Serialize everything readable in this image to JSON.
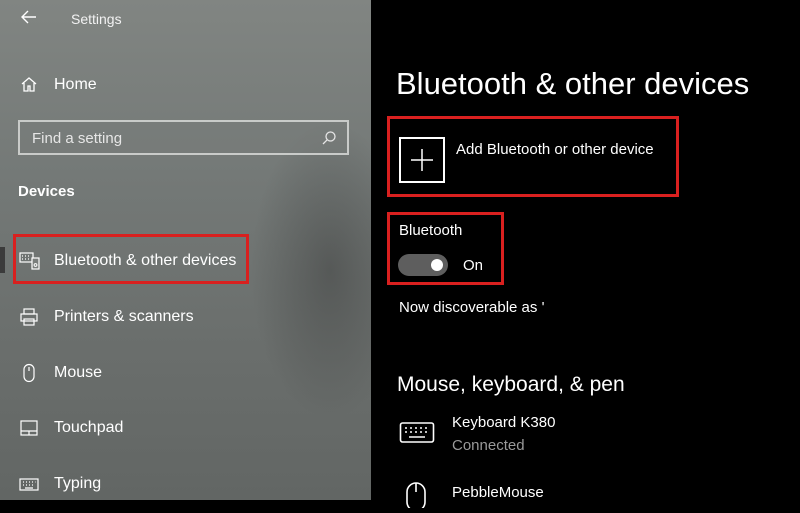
{
  "window": {
    "title": "Settings"
  },
  "sidebar": {
    "home_label": "Home",
    "search_placeholder": "Find a setting",
    "section_heading": "Devices",
    "items": [
      {
        "label": "Bluetooth & other devices",
        "icon": "bluetooth-devices-icon",
        "selected": true
      },
      {
        "label": "Printers & scanners",
        "icon": "printer-icon"
      },
      {
        "label": "Mouse",
        "icon": "mouse-icon"
      },
      {
        "label": "Touchpad",
        "icon": "touchpad-icon"
      },
      {
        "label": "Typing",
        "icon": "keyboard-icon"
      }
    ]
  },
  "main": {
    "title": "Bluetooth & other devices",
    "add_device_label": "Add Bluetooth or other device",
    "bluetooth": {
      "label": "Bluetooth",
      "state": "On",
      "enabled": true
    },
    "discoverable_text": "Now discoverable as '",
    "section_heading": "Mouse, keyboard, & pen",
    "devices": [
      {
        "name": "Keyboard K380",
        "status": "Connected",
        "icon": "keyboard-icon"
      },
      {
        "name": "PebbleMouse",
        "icon": "mouse-icon"
      }
    ]
  },
  "colors": {
    "highlight": "#d9201f",
    "sidebar_bg": "#757a77",
    "main_bg": "#000000",
    "secondary_text": "#9a9a9a"
  }
}
